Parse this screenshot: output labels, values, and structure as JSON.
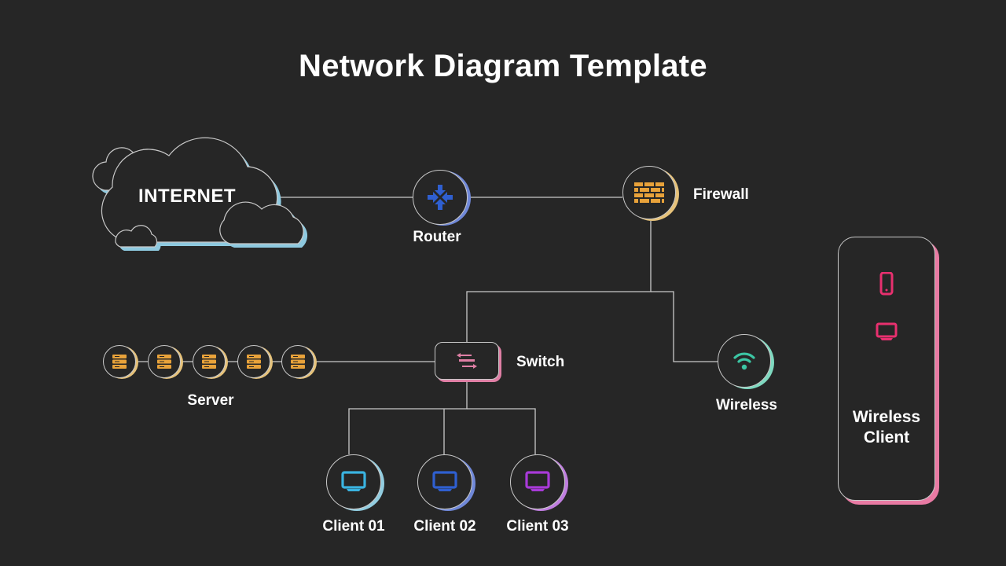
{
  "title": "Network Diagram Template",
  "colors": {
    "background": "#262626",
    "line": "#c9c9c9",
    "cloud_accent": "#8ec9df",
    "router": "#2f5fd0",
    "firewall": "#e8a23a",
    "server": "#e8a23a",
    "switch": "#e07fa5",
    "wireless": "#3cc6a4",
    "wireless_client": "#e8306f",
    "client01": "#3ab3e0",
    "client02": "#2f5fd0",
    "client03": "#a83ad8"
  },
  "nodes": {
    "internet": {
      "label": "INTERNET",
      "icon": "cloud-icon"
    },
    "router": {
      "label": "Router",
      "icon": "router-arrows-icon"
    },
    "firewall": {
      "label": "Firewall",
      "icon": "brick-wall-icon"
    },
    "switch": {
      "label": "Switch",
      "icon": "switch-arrows-icon"
    },
    "wireless": {
      "label": "Wireless",
      "icon": "wifi-icon"
    },
    "server": {
      "label": "Server",
      "icon": "server-icon",
      "count": 5
    },
    "clients": [
      {
        "label": "Client 01",
        "icon": "monitor-icon"
      },
      {
        "label": "Client 02",
        "icon": "monitor-icon"
      },
      {
        "label": "Client 03",
        "icon": "monitor-icon"
      }
    ],
    "wireless_client": {
      "label_line1": "Wireless",
      "label_line2": "Client",
      "icons": [
        "smartphone-icon",
        "monitor-icon"
      ]
    }
  }
}
